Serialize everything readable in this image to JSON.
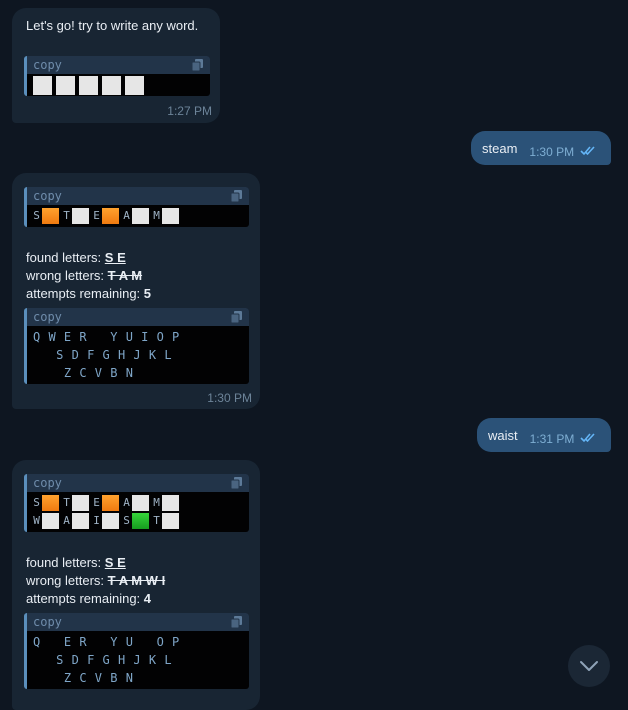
{
  "messages": {
    "intro": {
      "text": "Let's go! try to write any word.",
      "code_label": "copy",
      "time": "1:27 PM"
    },
    "user1": {
      "text": "steam",
      "time": "1:30 PM"
    },
    "result1": {
      "code_label": "copy",
      "row1": [
        "S",
        "T",
        "E",
        "A",
        "M"
      ],
      "found_label": "found letters: ",
      "found_value": "S E",
      "wrong_label": "wrong letters: ",
      "wrong_value": "T A M",
      "attempts_label": "attempts remaining: ",
      "attempts_value": "5",
      "kbd_label": "copy",
      "kbd_line1": "Q W E R   Y U I O P",
      "kbd_line2": "   S D F G H J K L",
      "kbd_line3": "    Z C V B N",
      "time": "1:30 PM"
    },
    "user2": {
      "text": "waist",
      "time": "1:31 PM"
    },
    "result2": {
      "code_label": "copy",
      "row1": [
        "S",
        "T",
        "E",
        "A",
        "M"
      ],
      "row2": [
        "W",
        "A",
        "I",
        "S",
        "T"
      ],
      "found_label": "found letters: ",
      "found_value": "S E",
      "wrong_label": "wrong letters: ",
      "wrong_value": "T A M W I",
      "attempts_label": "attempts remaining: ",
      "attempts_value": "4",
      "kbd_label": "copy",
      "kbd_line1": "Q   E R   Y U   O P",
      "kbd_line2": "   S D F G H J K L",
      "kbd_line3": "    Z C V B N"
    }
  },
  "colors": {
    "background": "#0e1621",
    "incoming_bubble": "#182533",
    "outgoing_bubble": "#2b5278",
    "tile_present": "#f58a1f",
    "tile_correct": "#22b52a",
    "tile_empty": "#e6e6e6"
  },
  "icons": {
    "copy": "copy-icon",
    "read": "double-check-icon",
    "scroll": "chevron-down-icon"
  }
}
